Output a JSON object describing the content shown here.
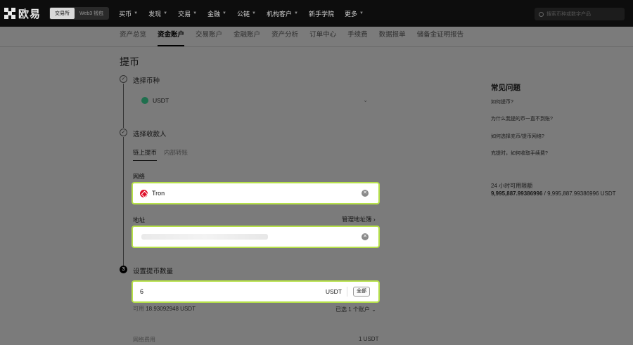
{
  "brand": {
    "name": "欧易"
  },
  "mode_switch": [
    "交易所",
    "Web3 钱包"
  ],
  "nav": [
    {
      "label": "买币",
      "dropdown": true
    },
    {
      "label": "发现",
      "dropdown": true
    },
    {
      "label": "交易",
      "dropdown": true
    },
    {
      "label": "金融",
      "dropdown": true
    },
    {
      "label": "公链",
      "dropdown": true
    },
    {
      "label": "机构客户",
      "dropdown": true
    },
    {
      "label": "新手学院",
      "dropdown": false
    },
    {
      "label": "更多",
      "dropdown": true
    }
  ],
  "search": {
    "placeholder": "搜索币种或数字产品"
  },
  "subnav": [
    "资产总览",
    "资金账户",
    "交易账户",
    "金融账户",
    "资产分析",
    "订单中心",
    "手续费",
    "数据报单",
    "储备金证明报告"
  ],
  "subnav_active_index": 1,
  "page_title": "提币",
  "steps": {
    "step1": {
      "title": "选择币种",
      "coin": "USDT"
    },
    "step2": {
      "title": "选择收款人",
      "tabs": [
        "链上提币",
        "内部转账"
      ],
      "network_label": "网络",
      "network_value": "Tron",
      "address_label": "地址",
      "address_book": "管理地址簿 ›"
    },
    "step3": {
      "number": "3",
      "title": "设置提币数量",
      "amount": "6",
      "unit": "USDT",
      "all_label": "全部",
      "available_label": "可用",
      "available_value": "18.93092948 USDT",
      "selected_accounts": "已选 1 个账户",
      "fee_label": "网络费用",
      "fee_value": "1 USDT"
    }
  },
  "faq": {
    "title": "常见问题",
    "items": [
      "如何提币?",
      "为什么我提的币一直不到账?",
      "如何选择充币/提币网络?",
      "充提时，如何收取手续费?"
    ]
  },
  "limit": {
    "label": "24 小时可用限额",
    "used": "9,995,887.99386996",
    "total": " / 9,995,887.99386996 USDT"
  },
  "colors": {
    "highlight_border": "#b6e04a",
    "tron_red": "#e0102a",
    "usdt_green": "#1f6f4e"
  }
}
